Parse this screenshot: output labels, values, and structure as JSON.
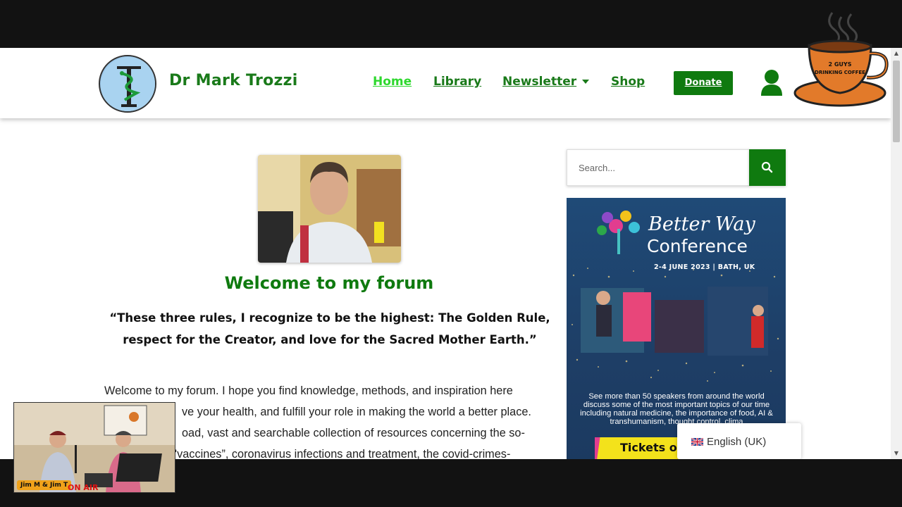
{
  "site": {
    "title": "Dr Mark Trozzi"
  },
  "nav": {
    "items": [
      {
        "label": "Home",
        "active": true
      },
      {
        "label": "Library",
        "active": false
      },
      {
        "label": "Newsletter",
        "active": false,
        "has_dropdown": true
      },
      {
        "label": "Shop",
        "active": false
      }
    ],
    "donate_label": "Donate"
  },
  "main": {
    "heading": "Welcome to my forum",
    "quote_line1": "“These three rules, I recognize to be the highest: The Golden Rule,",
    "quote_line2": "respect for the Creator, and love for the Sacred Mother Earth.”",
    "body_line1": "Welcome to my forum. I hope you find knowledge, methods, and inspiration here",
    "body_line2": "ve your health, and fulfill your role in making the world a better place.",
    "body_line3": "oad, vast and searchable collection of  resources concerning the so-",
    "body_line4": "'vaccines”, coronavirus infections and treatment, the covid-crimes-"
  },
  "sidebar": {
    "search_placeholder": "Search...",
    "banner": {
      "title_line1": "Better Way",
      "title_line2": "Conference",
      "date": "2-4 JUNE 2023  |  BATH, UK",
      "description": "See more than 50 speakers from around the world discuss some of the most important topics of our time including natural medicine, the importance of food, AI & transhumanism, thought control, clima",
      "tickets": "Tickets or"
    }
  },
  "language": {
    "label": "English (UK)"
  },
  "overlay": {
    "coffee_logo_text_line1": "2 GUYS",
    "coffee_logo_text_line2": "DRINKING COFFEE",
    "pip_name": "Jim M & Jim T",
    "pip_onair": "ON AIR"
  },
  "colors": {
    "brand_green": "#0f7a0f",
    "active_nav": "#2ed82e"
  }
}
